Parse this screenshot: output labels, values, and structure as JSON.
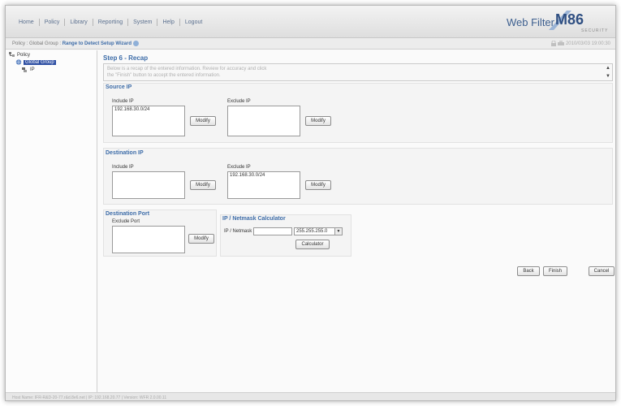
{
  "nav": {
    "items": [
      "Home",
      "Policy",
      "Library",
      "Reporting",
      "System",
      "Help",
      "Logout"
    ]
  },
  "header": {
    "product": "Web Filter",
    "logo_main": "M86",
    "logo_sub": "SECURITY"
  },
  "breadcrumb": {
    "lead": "Policy : Global Group : ",
    "current": "Range to Detect Setup Wizard",
    "timestamp": "2010/03/03 19:00:30"
  },
  "tree": {
    "root": "Policy",
    "group": "Global Group",
    "ip": "IP"
  },
  "wizard": {
    "step_title": "Step 6 - Recap",
    "intro_line1": "Below is a recap of the entered information. Review for accuracy and click",
    "intro_line2": "the \"Finish\" button to accept the entered information."
  },
  "source_ip": {
    "title": "Source IP",
    "include_label": "Include IP",
    "include_value": "192.168.30.0/24",
    "exclude_label": "Exclude IP",
    "exclude_value": ""
  },
  "destination_ip": {
    "title": "Destination IP",
    "include_label": "Include IP",
    "include_value": "",
    "exclude_label": "Exclude IP",
    "exclude_value": "192.168.30.0/24"
  },
  "destination_port": {
    "title": "Destination Port",
    "exclude_label": "Exclude Port",
    "exclude_value": ""
  },
  "calculator": {
    "title": "IP / Netmask Calculator",
    "field_label": "IP / Netmask",
    "ip_value": "",
    "netmask_value": "255.255.255.0",
    "button": "Calculator"
  },
  "buttons": {
    "modify": "Modify",
    "back": "Back",
    "finish": "Finish",
    "cancel": "Cancel"
  },
  "status": {
    "text": "Host Name: IFR-R&D-20-77.r&d.8e6.net  |  IP: 192.168.20.77  |  Version: WFR 2.0.00.11"
  },
  "colors": {
    "accent": "#3d6ca8",
    "selection": "#2e4fa3"
  }
}
